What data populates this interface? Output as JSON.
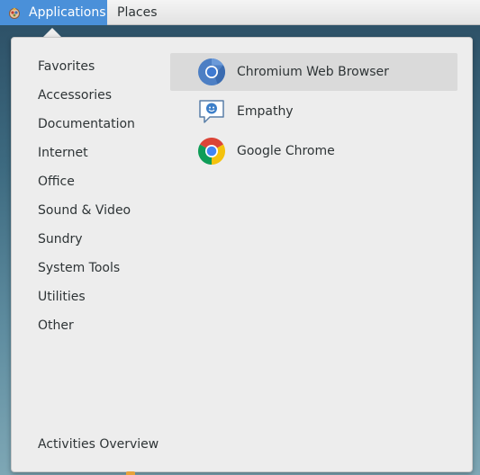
{
  "topbar": {
    "applications_label": "Applications",
    "places_label": "Places",
    "accent_color": "#4a90d9"
  },
  "menu": {
    "categories": [
      {
        "label": "Favorites"
      },
      {
        "label": "Accessories"
      },
      {
        "label": "Documentation"
      },
      {
        "label": "Internet"
      },
      {
        "label": "Office"
      },
      {
        "label": "Sound & Video"
      },
      {
        "label": "Sundry"
      },
      {
        "label": "System Tools"
      },
      {
        "label": "Utilities"
      },
      {
        "label": "Other"
      }
    ],
    "apps": [
      {
        "label": "Chromium Web Browser",
        "icon": "chromium-icon",
        "selected": true
      },
      {
        "label": "Empathy",
        "icon": "empathy-icon",
        "selected": false
      },
      {
        "label": "Google Chrome",
        "icon": "google-chrome-icon",
        "selected": false
      }
    ],
    "activities_overview_label": "Activities Overview"
  }
}
